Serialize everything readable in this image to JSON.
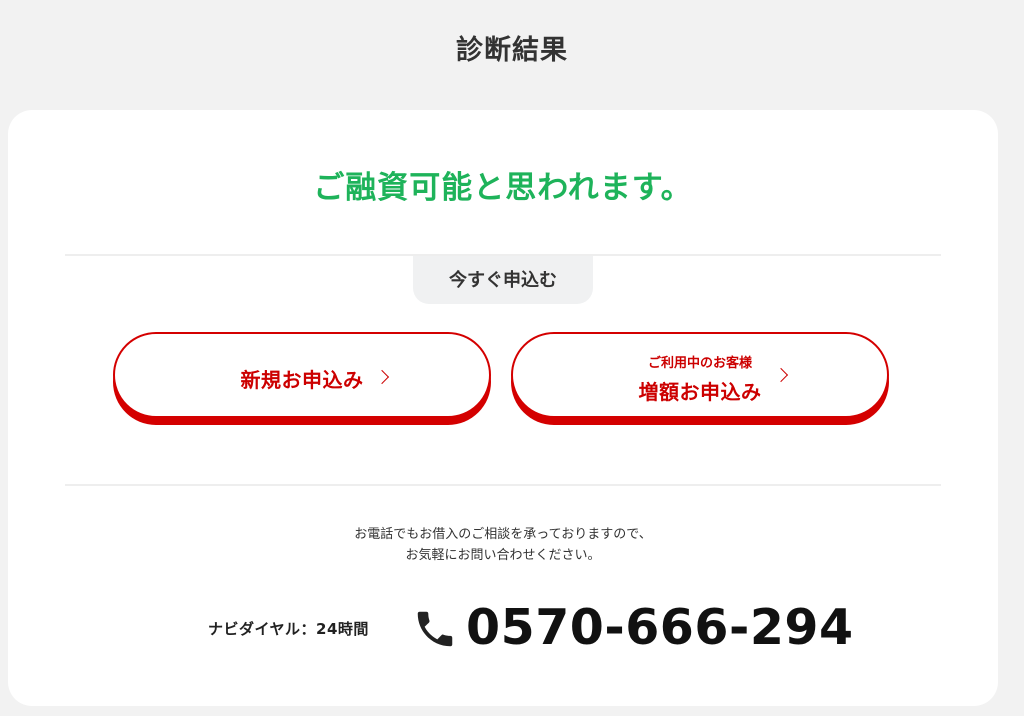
{
  "page": {
    "title": "診断結果"
  },
  "result": {
    "headline": "ご融資可能と思われます。",
    "headline_color": "#1eb35a"
  },
  "apply": {
    "tab_label": "今すぐ申込む",
    "new_button": {
      "label": "新規お申込み",
      "icon": "chevron-right-icon"
    },
    "increase_button": {
      "sublabel": "ご利用中のお客様",
      "label": "増額お申込み",
      "icon": "chevron-right-icon"
    },
    "accent_color": "#d40000"
  },
  "contact": {
    "note_line1": "お電話でもお借入のご相談を承っておりますので、",
    "note_line2": "お気軽にお問い合わせください。",
    "dial_label": "ナビダイヤル：24時間",
    "phone_icon": "phone-icon",
    "phone_number": "0570-666-294"
  }
}
